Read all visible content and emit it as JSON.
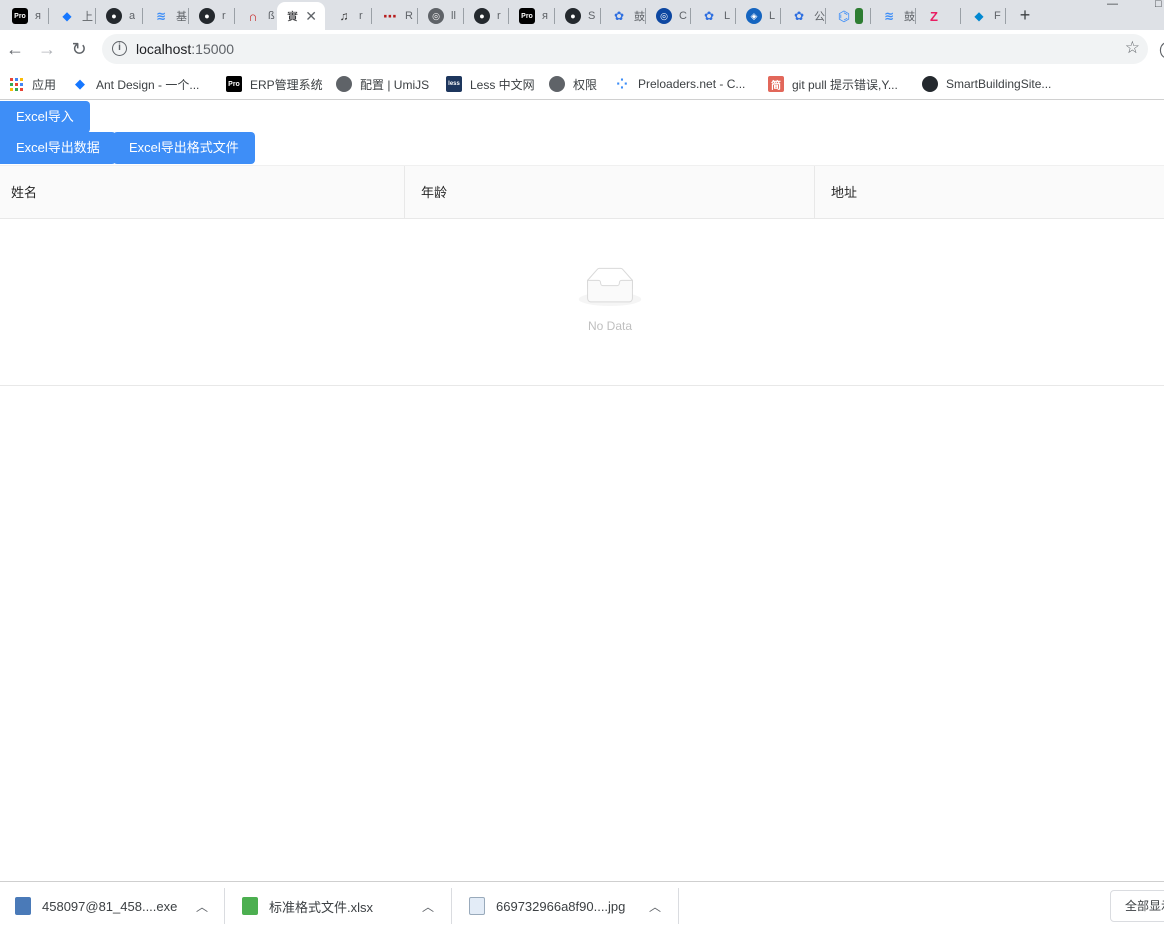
{
  "tabs": [
    {
      "icon": "pro-icon",
      "label": "Pro",
      "title": "я",
      "bg": "#000000"
    },
    {
      "icon": "antd-diamond-icon",
      "label": "◆",
      "title": "上",
      "bg": "#ffffff"
    },
    {
      "icon": "github-icon",
      "label": "●",
      "title": "a",
      "bg": "#24292e"
    },
    {
      "icon": "yuque-icon",
      "label": "≋",
      "title": "基",
      "bg": "#ffffff"
    },
    {
      "icon": "github-icon",
      "label": "●",
      "title": "r",
      "bg": "#24292e"
    },
    {
      "icon": "arc-icon",
      "label": "∩",
      "title": "ß",
      "bg": "#ffffff"
    },
    {
      "icon": "page-icon",
      "label": "",
      "title": "實",
      "bg": "#ffffff"
    },
    {
      "icon": "ant-icon",
      "label": "♫",
      "title": "r",
      "bg": "#ffffff"
    },
    {
      "icon": "dots-icon",
      "label": "⋯",
      "title": "R",
      "bg": "#ffffff"
    },
    {
      "icon": "globe-icon",
      "label": "◎",
      "title": "ll",
      "bg": "#5f6368"
    },
    {
      "icon": "github-icon",
      "label": "●",
      "title": "r",
      "bg": "#24292e"
    },
    {
      "icon": "pro-icon",
      "label": "Pro",
      "title": "я",
      "bg": "#000000"
    },
    {
      "icon": "github-icon",
      "label": "●",
      "title": "S",
      "bg": "#24292e"
    },
    {
      "icon": "baidu-icon",
      "label": "✿",
      "title": "鼓",
      "bg": "#ffffff"
    },
    {
      "icon": "circle-link-icon",
      "label": "◎",
      "title": "C",
      "bg": "#0d47a1"
    },
    {
      "icon": "baidu-icon",
      "label": "✿",
      "title": "L",
      "bg": "#ffffff"
    },
    {
      "icon": "vscode-icon",
      "label": "◈",
      "title": "L",
      "bg": "#1565c0"
    },
    {
      "icon": "baidu-icon",
      "label": "✿",
      "title": "公",
      "bg": "#ffffff"
    },
    {
      "icon": "wechat-icon",
      "label": "⌬",
      "title": "",
      "bg": "#ffffff"
    },
    {
      "icon": "yuque-icon",
      "label": "≋",
      "title": "鼓",
      "bg": "#ffffff"
    },
    {
      "icon": "zhihu-icon",
      "label": "Z",
      "title": "",
      "bg": "#ffffff"
    },
    {
      "icon": "bird-icon",
      "label": "◆",
      "title": "F",
      "bg": "#ffffff"
    }
  ],
  "address": {
    "host": "localhost",
    "port": ":15000"
  },
  "bookmarks": [
    {
      "icon": "apps-grid-icon",
      "label": "应用"
    },
    {
      "icon": "antd-diamond-icon",
      "label": "Ant Design - 一个..."
    },
    {
      "icon": "pro-icon",
      "label": "ERP管理系统"
    },
    {
      "icon": "globe-icon",
      "label": "配置 | UmiJS"
    },
    {
      "icon": "less-icon",
      "label": "Less 中文网"
    },
    {
      "icon": "globe-icon",
      "label": "权限"
    },
    {
      "icon": "spinner-icon",
      "label": "Preloaders.net - C..."
    },
    {
      "icon": "jianshu-icon",
      "label": "git pull 提示错误,Y..."
    },
    {
      "icon": "github-icon",
      "label": "SmartBuildingSite..."
    }
  ],
  "buttons": {
    "import": "Excel导入",
    "export_data": "Excel导出数据",
    "export_format": "Excel导出格式文件"
  },
  "table": {
    "columns": [
      "姓名",
      "年龄",
      "地址"
    ],
    "empty_text": "No Data"
  },
  "downloads": [
    {
      "icon": "exe-file-icon",
      "name": "458097@81_458....exe"
    },
    {
      "icon": "xlsx-file-icon",
      "name": "标准格式文件.xlsx"
    },
    {
      "icon": "jpg-file-icon",
      "name": "669732966a8f90....jpg"
    }
  ],
  "show_all": "全部显示",
  "colors": {
    "primary": "#3e8ef7",
    "tabstrip": "#dee1e6"
  }
}
